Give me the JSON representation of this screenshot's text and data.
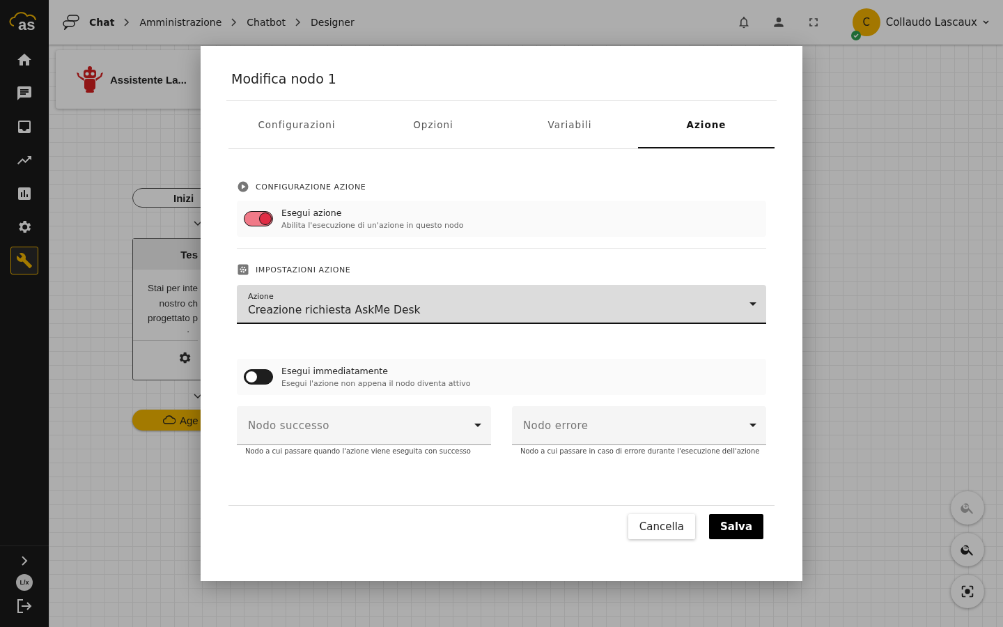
{
  "sidebar": {
    "logo": "as",
    "nav_items": [
      {
        "selected": false
      },
      {
        "selected": false
      },
      {
        "selected": false
      },
      {
        "selected": false
      },
      {
        "selected": false
      },
      {
        "selected": false
      },
      {
        "selected": true
      }
    ],
    "footer_badge": "L/x"
  },
  "breadcrumbs": [
    "Chat",
    "Amministrazione",
    "Chatbot",
    "Designer"
  ],
  "user": {
    "initial": "C",
    "name": "Collaudo Lascaux",
    "online": true
  },
  "canvas": {
    "bot_name": "Assistente La...",
    "start_node": "Inizi",
    "text_node": {
      "title": "Tes",
      "lines": [
        "Stai per inte",
        "nostro ch",
        "progettato p",
        "."
      ]
    },
    "agent_node": "Age",
    "zoom_controls": [
      {
        "disabled": true
      },
      {
        "disabled": false
      },
      {
        "disabled": false
      }
    ]
  },
  "modal": {
    "title": "Modifica nodo 1",
    "tabs": [
      {
        "label": "Configurazioni",
        "selected": false
      },
      {
        "label": "Opzioni",
        "selected": false
      },
      {
        "label": "Variabili",
        "selected": false
      },
      {
        "label": "Azione",
        "selected": true
      }
    ],
    "section_1": {
      "title": "CONFIGURAZIONE AZIONE"
    },
    "execute_action": {
      "label": "Esegui azione",
      "description": "Abilita l'esecuzione di un'azione in questo nodo",
      "on": true
    },
    "section_2": {
      "title": "IMPOSTAZIONI AZIONE"
    },
    "action_select": {
      "label": "Azione",
      "value": "Creazione richiesta AskMe Desk"
    },
    "execute_now": {
      "label": "Esegui immediatamente",
      "description": "Esegui l'azione non appena il nodo diventa attivo",
      "on": false
    },
    "success_select": {
      "placeholder": "Nodo successo",
      "hint": "Nodo a cui passare quando l'azione viene eseguita con successo"
    },
    "error_select": {
      "placeholder": "Nodo errore",
      "hint": "Nodo a cui passare in caso di errore durante l'esecuzione dell'azione"
    },
    "buttons": [
      {
        "label": "Cancella",
        "kind": "secondary"
      },
      {
        "label": "Salva",
        "kind": "primary"
      }
    ]
  }
}
